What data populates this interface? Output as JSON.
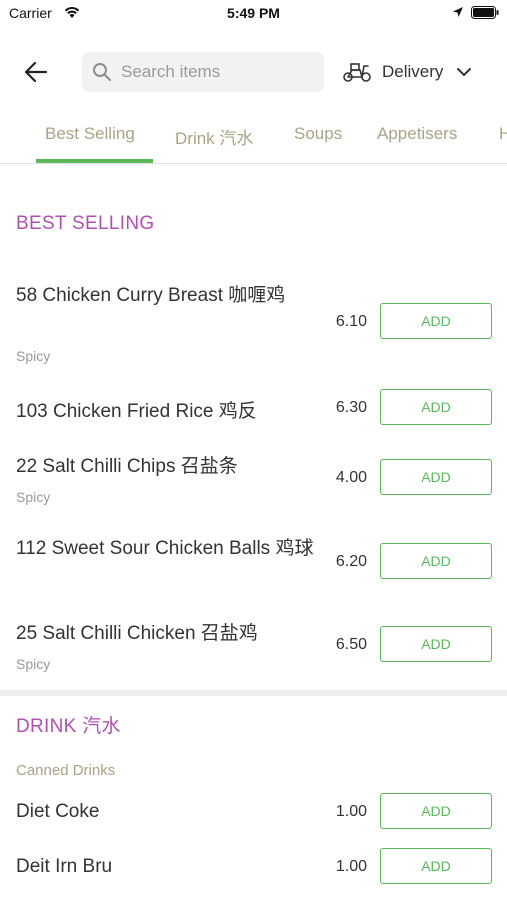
{
  "status_bar": {
    "carrier": "Carrier",
    "time": "5:49 PM"
  },
  "top_bar": {
    "search_placeholder": "Search items",
    "delivery_label": "Delivery"
  },
  "tabs": [
    {
      "label": "Best Selling"
    },
    {
      "label": "Drink 汽水"
    },
    {
      "label": "Soups"
    },
    {
      "label": "Appetisers"
    },
    {
      "label": "H"
    }
  ],
  "sections": {
    "best_selling": {
      "title": "BEST SELLING",
      "items": [
        {
          "name": "58 Chicken Curry Breast 咖喱鸡",
          "tag": "Spicy",
          "price": "6.10",
          "add": "ADD"
        },
        {
          "name": "103 Chicken Fried Rice 鸡反",
          "tag": "",
          "price": "6.30",
          "add": "ADD"
        },
        {
          "name": "22 Salt Chilli Chips 召盐条",
          "tag": "Spicy",
          "price": "4.00",
          "add": "ADD"
        },
        {
          "name": "112 Sweet Sour Chicken Balls 鸡球",
          "tag": "",
          "price": "6.20",
          "add": "ADD"
        },
        {
          "name": "25 Salt Chilli Chicken 召盐鸡",
          "tag": "Spicy",
          "price": "6.50",
          "add": "ADD"
        }
      ]
    },
    "drink": {
      "title": "DRINK 汽水",
      "subtitle": "Canned Drinks",
      "items": [
        {
          "name": "Diet Coke",
          "price": "1.00",
          "add": "ADD"
        },
        {
          "name": "Deit Irn Bru",
          "price": "1.00",
          "add": "ADD"
        }
      ]
    }
  },
  "colors": {
    "accent_green": "#5cb85c",
    "section_purple": "#b14fb2",
    "tab_olive": "#a9a487"
  },
  "icons": [
    "wifi-icon",
    "location-arrow-icon",
    "battery-icon",
    "back-arrow-icon",
    "search-icon",
    "scooter-icon",
    "chevron-down-icon"
  ]
}
